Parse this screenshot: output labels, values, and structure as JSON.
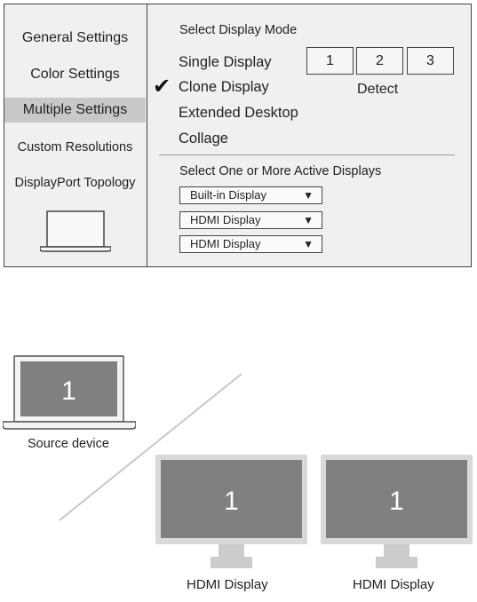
{
  "sidebar": {
    "items": [
      {
        "label": "General Settings"
      },
      {
        "label": "Color Settings"
      },
      {
        "label": "Multiple Settings",
        "active": true
      },
      {
        "label": "Custom Resolutions"
      },
      {
        "label": "DisplayPort Topology"
      }
    ],
    "icon": "laptop-icon"
  },
  "display_mode": {
    "heading": "Select Display Mode",
    "modes": [
      {
        "label": "Single Display",
        "selected": false
      },
      {
        "label": "Clone Display",
        "selected": true
      },
      {
        "label": "Extended Desktop",
        "selected": false
      },
      {
        "label": "Collage",
        "selected": false
      }
    ],
    "check_icon": "✔",
    "display_numbers": [
      "1",
      "2",
      "3"
    ],
    "detect_label": "Detect"
  },
  "active_displays": {
    "heading": "Select One or More Active Displays",
    "dropdowns": [
      {
        "value": "Built-in Display"
      },
      {
        "value": "HDMI Display"
      },
      {
        "value": "HDMI Display"
      }
    ],
    "arrow": "▼"
  },
  "illustration": {
    "source": {
      "number": "1",
      "label": "Source device"
    },
    "monitors": [
      {
        "number": "1",
        "label": "HDMI Display"
      },
      {
        "number": "1",
        "label": "HDMI Display"
      }
    ],
    "colors": {
      "screen": "#808080",
      "frame": "#d9d9d9",
      "stand": "#cccccc"
    }
  }
}
